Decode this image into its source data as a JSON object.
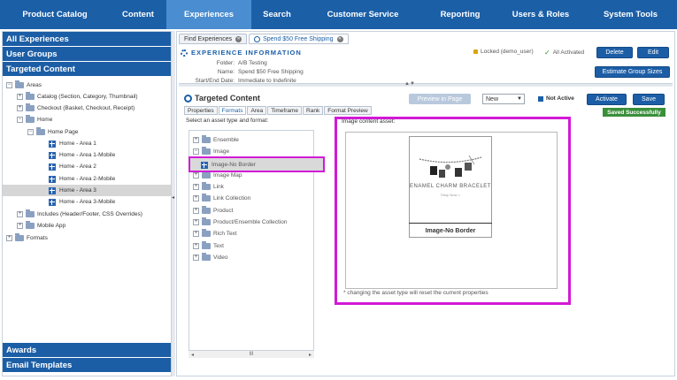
{
  "topnav": {
    "items": [
      {
        "label": "Product Catalog"
      },
      {
        "label": "Content"
      },
      {
        "label": "Experiences"
      },
      {
        "label": "Search"
      },
      {
        "label": "Customer Service"
      },
      {
        "label": "Reporting"
      },
      {
        "label": "Users & Roles"
      },
      {
        "label": "System Tools"
      }
    ],
    "active_index": 2
  },
  "left": {
    "headers": [
      "All Experiences",
      "User Groups",
      "Targeted Content"
    ],
    "tree": [
      {
        "label": "Areas"
      },
      {
        "label": "Catalog (Section, Category, Thumbnail)"
      },
      {
        "label": "Checkout (Basket, Checkout, Receipt)"
      },
      {
        "label": "Home"
      },
      {
        "label": "Home Page"
      },
      {
        "label": "Home - Area 1"
      },
      {
        "label": "Home - Area 1-Mobile"
      },
      {
        "label": "Home - Area 2"
      },
      {
        "label": "Home - Area 2-Mobile"
      },
      {
        "label": "Home - Area 3"
      },
      {
        "label": "Home - Area 3-Mobile"
      },
      {
        "label": "Includes (Header/Footer, CSS Overrides)"
      },
      {
        "label": "Mobile App"
      },
      {
        "label": "Formats"
      }
    ],
    "bottom_headers": [
      "Awards",
      "Email Templates"
    ]
  },
  "tabs": [
    {
      "label": "Find Experiences"
    },
    {
      "label": "Spend $50 Free Shipping"
    }
  ],
  "experience": {
    "title": "EXPERIENCE INFORMATION",
    "folder_label": "Folder:",
    "folder": "A/B Testing",
    "name_label": "Name:",
    "name": "Spend $50 Free Shipping",
    "dates_label": "Start/End Date:",
    "dates": "Immediate to Indefinite",
    "locked": "Locked (demo_user)",
    "activated": "All Activated",
    "delete_label": "Delete",
    "edit_label": "Edit",
    "estimate_label": "Estimate Group Sizes"
  },
  "targeted": {
    "title": "Targeted Content",
    "preview_label": "Preview in Page",
    "select_value": "New",
    "not_active": "Not Active",
    "activate_label": "Activate",
    "save_label": "Save",
    "saved_badge": "Saved Successfully",
    "subtabs": [
      "Properties",
      "Formats",
      "Area",
      "Timeframe",
      "Rank",
      "Format Preview"
    ],
    "active_subtab": 1,
    "asset_prompt": "Select an asset type and format:",
    "assets": [
      {
        "label": "Ensemble"
      },
      {
        "label": "Image"
      },
      {
        "label": "Image-No Border"
      },
      {
        "label": "Image Map"
      },
      {
        "label": "Link"
      },
      {
        "label": "Link Collection"
      },
      {
        "label": "Product"
      },
      {
        "label": "Product/Ensemble Collection"
      },
      {
        "label": "Rich Text"
      },
      {
        "label": "Text"
      },
      {
        "label": "Video"
      }
    ],
    "scroll_thumb": "III",
    "preview_caption": "Image content asset:",
    "product_name": "ENAMEL CHARM BRACELET",
    "product_sub": "Shop Now >",
    "thumb_caption": "Image-No Border",
    "note": "* changing the asset type will reset the current properties"
  }
}
